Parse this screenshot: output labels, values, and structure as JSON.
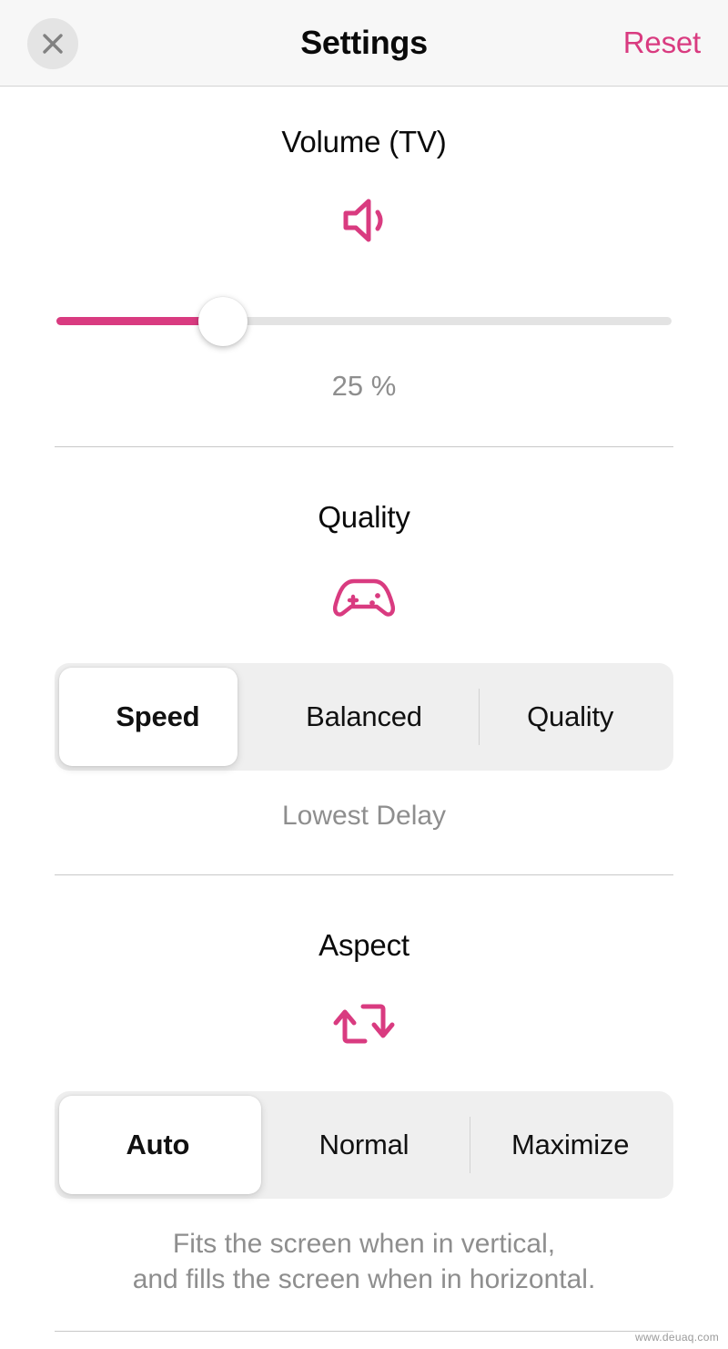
{
  "header": {
    "title": "Settings",
    "close_icon": "close-icon",
    "reset_label": "Reset"
  },
  "sections": {
    "volume": {
      "title": "Volume (TV)",
      "icon": "speaker-volume-icon",
      "value_label": "25 %",
      "slider": {
        "value": 25,
        "min": 0,
        "max": 100,
        "fill_percent": 27
      }
    },
    "quality": {
      "title": "Quality",
      "icon": "gamepad-icon",
      "options": [
        "Speed",
        "Balanced",
        "Quality"
      ],
      "selected_index": 0,
      "caption": "Lowest Delay"
    },
    "aspect": {
      "title": "Aspect",
      "icon": "rotate-repeat-icon",
      "options": [
        "Auto",
        "Normal",
        "Maximize"
      ],
      "selected_index": 0,
      "caption_line1": "Fits the screen when in vertical,",
      "caption_line2": "and fills the screen when in horizontal."
    }
  },
  "watermark": "www.deuaq.com",
  "colors": {
    "accent": "#d93b80",
    "header_bg": "#f7f7f7",
    "track": "#e3e3e3",
    "segment_bg": "#efefef",
    "muted_text": "#8e8e8e"
  }
}
